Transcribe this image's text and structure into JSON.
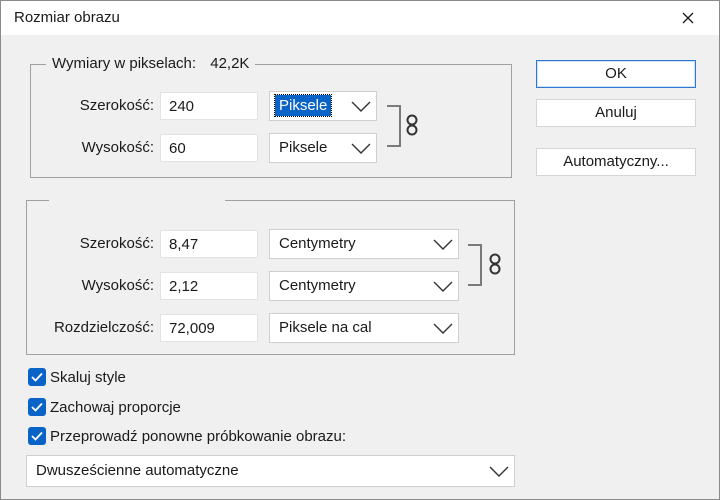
{
  "window": {
    "title": "Rozmiar obrazu",
    "close_icon": "close-icon"
  },
  "pixel_dimensions": {
    "legend_label": "Wymiary w pikselach:",
    "legend_value": "42,2K",
    "width": {
      "label": "Szerokość:",
      "value": "240",
      "unit": "Piksele"
    },
    "height": {
      "label": "Wysokość:",
      "value": "60",
      "unit": "Piksele"
    },
    "link_icon": "chain-link-icon"
  },
  "document_size": {
    "width": {
      "label": "Szerokość:",
      "value": "8,47",
      "unit": "Centymetry"
    },
    "height": {
      "label": "Wysokość:",
      "value": "2,12",
      "unit": "Centymetry"
    },
    "resolution": {
      "label": "Rozdzielczość:",
      "value": "72,009",
      "unit": "Piksele na cal"
    },
    "link_icon": "chain-link-icon"
  },
  "buttons": {
    "ok": "OK",
    "cancel": "Anuluj",
    "auto": "Automatyczny..."
  },
  "options": {
    "scale_styles": {
      "label": "Skaluj style",
      "checked": true
    },
    "constrain_proportions": {
      "label": "Zachowaj proporcje",
      "checked": true
    },
    "resample": {
      "label": "Przeprowadź ponowne próbkowanie obrazu:",
      "checked": true
    }
  },
  "resample_method": "Dwusześcienne automatyczne",
  "colors": {
    "accent": "#0a64c8",
    "default_button_border": "#2d78d4",
    "background": "#f0f0f0"
  }
}
